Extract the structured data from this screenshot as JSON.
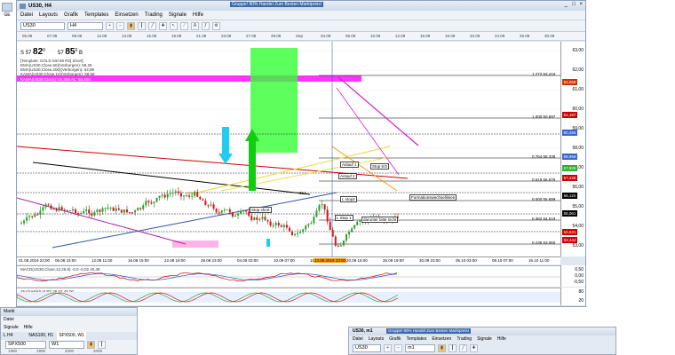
{
  "colors": {
    "magenta_band": "#ff33ff",
    "green_zone": "#33ff33",
    "cyan_arrow": "#22ccee",
    "green_arrow": "#11cc11",
    "orange_line": "#ff9900",
    "price_box": "#cc0000",
    "yellow_line": "#e8e04a"
  },
  "main_window": {
    "title": "US30, H4",
    "menu": [
      "Datei",
      "Layouts",
      "Grafik",
      "Templates",
      "Einsetzen",
      "Trading",
      "Signale",
      "Hilfe"
    ],
    "symbol": "US30",
    "timeframe": "H4",
    "top_dates": [
      "05.08",
      "07.08",
      "09.08",
      "12.08",
      "13.08",
      "15.08",
      "19.08",
      "21.08",
      "23.08",
      "27.08",
      "29.08",
      "Sep",
      "04.09",
      "06.09",
      "10.09",
      "12.09",
      "16.09",
      "18.09",
      "20.09",
      "24.09",
      "26.09",
      "30.09"
    ],
    "overlay_top": "Gruppe! 90% Handel Zum Besten Marktpreis!",
    "bid_prefix": "S",
    "bid_small": "57",
    "bid_big": "82",
    "bid_sup": "0",
    "ask_prefix": "57",
    "ask_big": "85",
    "ask_sup": "0",
    "ask_suffix": "B",
    "legend": [
      "[Template: GOLD inkl 88 R2] Short]",
      "EMA(US30,Close,50)(Verborgen): 58,26",
      "EMA(US30,Close,200)(Verborgen): 54,99",
      "KAMA(US30,Close,14)(Verborgen): 58,68"
    ],
    "magenta_text": "KAMA(US30,Close): 56,466  AL: 56,486",
    "fib_levels": [
      {
        "label": "1.272 63.416"
      },
      {
        "label": "1.000 60.697"
      },
      {
        "label": "0.764 58.338"
      },
      {
        "label": "0.618 56.879"
      },
      {
        "label": "0.500 55.699"
      },
      {
        "label": "0.382 54.519"
      },
      {
        "label": "0.236 53.060"
      }
    ],
    "price_labels": [
      "63,00",
      "62,00",
      "61,00",
      "60,00",
      "59,00",
      "58,00",
      "57,00",
      "56,00",
      "55,00",
      "54,00",
      "53,00"
    ],
    "price_boxes": [
      "63,069",
      "61,187",
      "60,256",
      "58,969",
      "57,826",
      "57,229",
      "56,122",
      "55,061",
      "53,831",
      "53,444"
    ],
    "time_labels": [
      "01.08.2019 23:00",
      "06.08 23:00",
      "12.08 11:00",
      "16.08 15:00",
      "22.08 19:00",
      "28.08 23:00",
      "04.09 03:00",
      "10.09 07:00",
      "16.09 11:00",
      "20.09 15:00",
      "26.09 19:00",
      "30.09 23:00",
      "05.10 03:00",
      "09.10 07:00",
      "15.10 11:00"
    ],
    "time_highlight": "13.09.2019 23:00",
    "annotations": {
      "anlauf": "Anlauf 1",
      "anlauf2": "Anlauf 2",
      "stoploss_top": "Stop KO",
      "formation": "Formationswechsellinien",
      "lstop2": "L stop2",
      "stop_short": "Stop short",
      "lstop1": "L Stop 1",
      "darunter": "darunter bitte nicht",
      "sl1": "SL1"
    },
    "ind1_text": "MACD(US30,Close,12,26,9)  -0,0  -0,02  40,48",
    "ind2_text": "Stochastik(US30)  38,62  48,00",
    "ind1_scale": [
      "0,50",
      "0,00",
      "-0,50"
    ],
    "ind2_scale": [
      "80",
      "20"
    ]
  },
  "left_window": {
    "title": "Markt",
    "menu": [
      "Datei",
      "Signale",
      "Hilfe"
    ],
    "tabs": [
      "L H4",
      "NAS100, H1",
      "SPX500, W1"
    ],
    "symbol": "SPX500",
    "timeframe": "W1",
    "years": [
      "1990",
      "1995",
      "2000",
      "2005"
    ]
  },
  "right_window": {
    "title": "US30, m1",
    "overlay": "Gruppe! 90% Handel Zum Besten Marktpreis!",
    "menu": [
      "Datei",
      "Layouts",
      "Grafik",
      "Templates",
      "Einsetzen",
      "Trading",
      "Signale",
      "Hilfe"
    ],
    "symbol": "US30",
    "timeframe": "m1"
  },
  "desktop_icon_label": "GE"
}
